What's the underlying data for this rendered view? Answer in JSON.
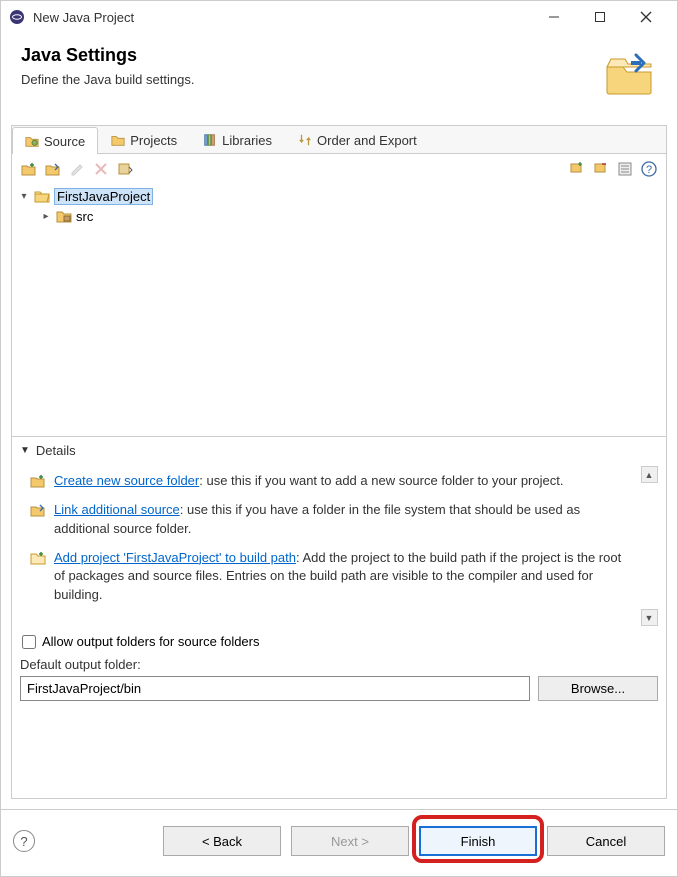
{
  "window": {
    "title": "New Java Project"
  },
  "banner": {
    "heading": "Java Settings",
    "subheading": "Define the Java build settings."
  },
  "tabs": {
    "source": "Source",
    "projects": "Projects",
    "libraries": "Libraries",
    "order_export": "Order and Export"
  },
  "tree": {
    "project_name": "FirstJavaProject",
    "src_label": "src"
  },
  "details": {
    "heading": "Details",
    "items": [
      {
        "link": "Create new source folder",
        "text": ": use this if you want to add a new source folder to your project."
      },
      {
        "link": "Link additional source",
        "text": ": use this if you have a folder in the file system that should be used as additional source folder."
      },
      {
        "link": "Add project 'FirstJavaProject' to build path",
        "text": ": Add the project to the build path if the project is the root of packages and source files. Entries on the build path are visible to the compiler and used for building."
      }
    ]
  },
  "checkbox": {
    "allow_output_label": "Allow output folders for source folders"
  },
  "output": {
    "label": "Default output folder:",
    "value": "FirstJavaProject/bin",
    "browse": "Browse..."
  },
  "footer": {
    "back": "< Back",
    "next": "Next >",
    "finish": "Finish",
    "cancel": "Cancel"
  }
}
